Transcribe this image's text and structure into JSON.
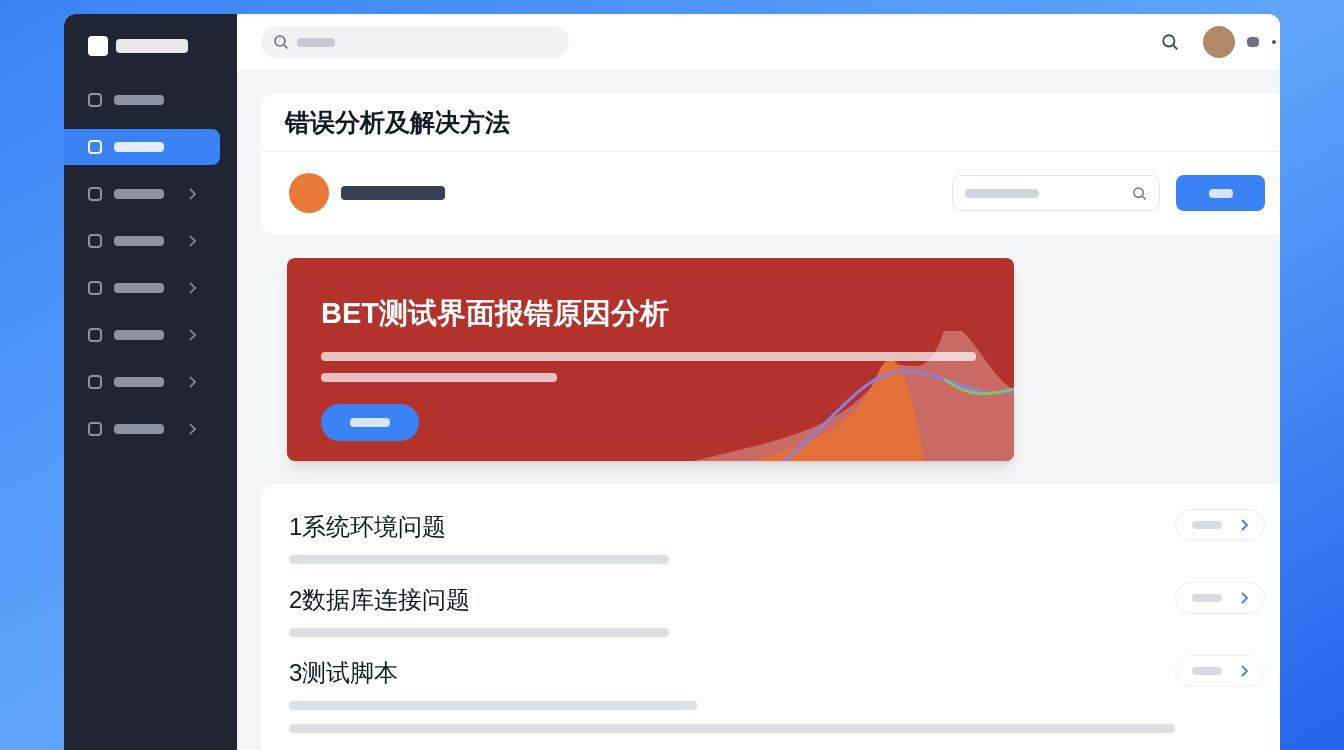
{
  "sidebar": {
    "items": [
      {
        "selected": false,
        "expandable": false
      },
      {
        "selected": true,
        "expandable": false
      },
      {
        "selected": false,
        "expandable": true
      },
      {
        "selected": false,
        "expandable": true
      },
      {
        "selected": false,
        "expandable": true
      },
      {
        "selected": false,
        "expandable": true
      },
      {
        "selected": false,
        "expandable": true
      },
      {
        "selected": false,
        "expandable": true
      }
    ]
  },
  "page": {
    "title": "错误分析及解决方法"
  },
  "banner": {
    "title": "BET测试界面报错原因分析"
  },
  "sections": [
    {
      "title": "1系统环境问题",
      "kind": "single"
    },
    {
      "title": "2数据库连接问题",
      "kind": "single"
    },
    {
      "title": "3测试脚本",
      "kind": "double"
    }
  ]
}
